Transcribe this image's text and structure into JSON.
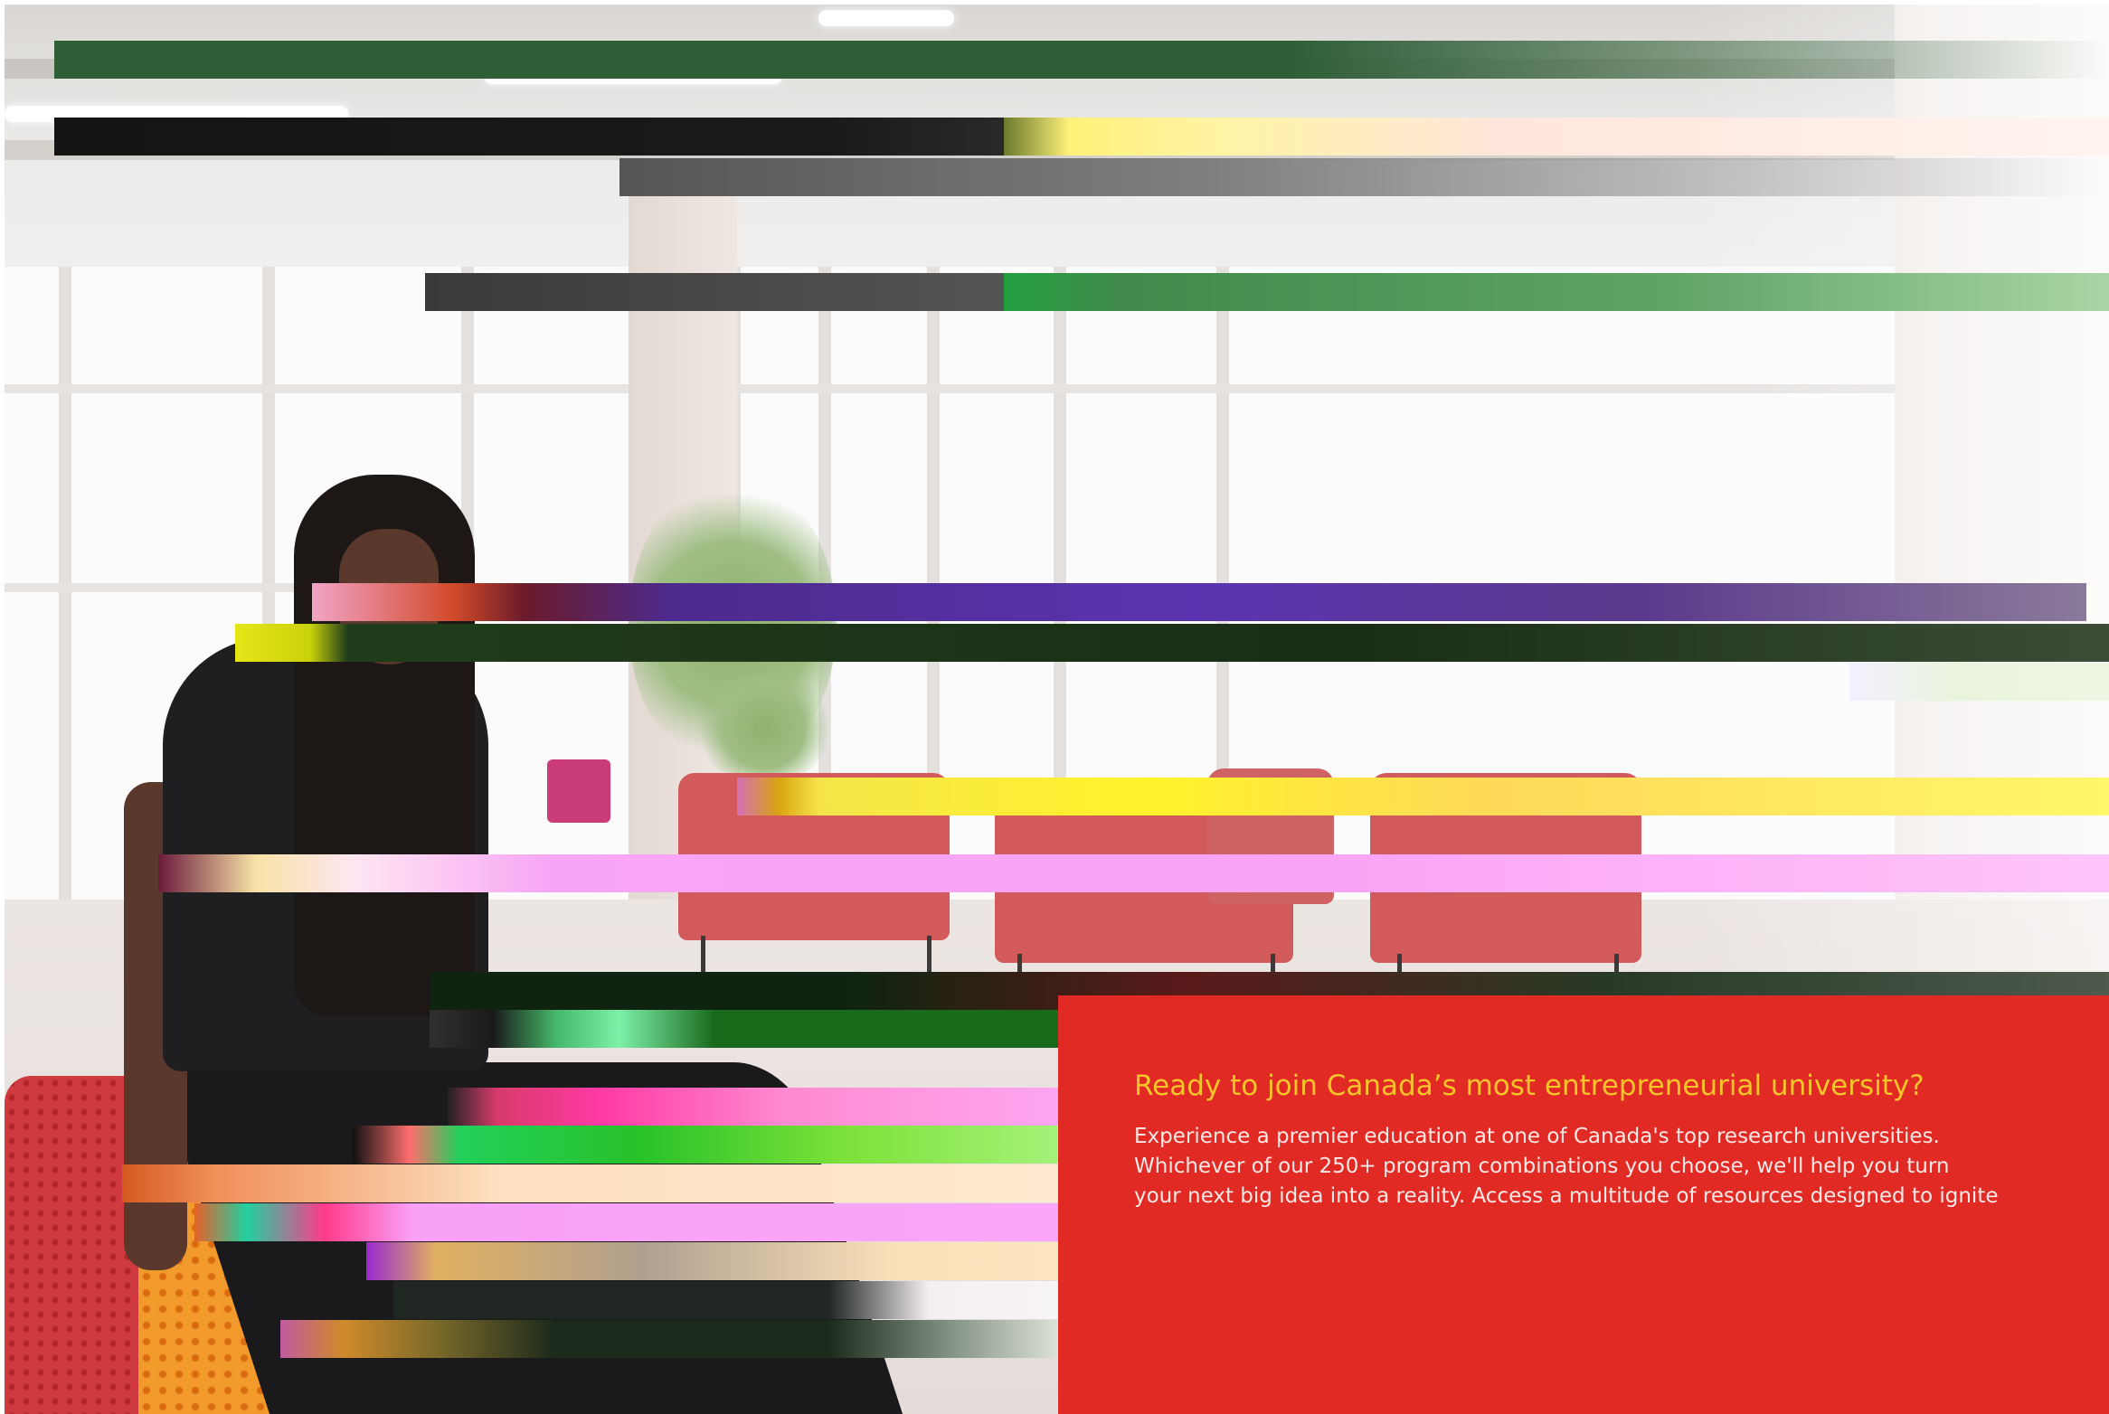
{
  "hero": {
    "image_alt": "",
    "glitch_colors": [
      "#2e5e36",
      "#141414",
      "#6a7a2c",
      "#fff27a",
      "#ffe6dc",
      "#555555",
      "#3f8a4a",
      "#4d2a8c",
      "#1f3d1a",
      "#f6e54a",
      "#f7a6f5",
      "#0f2410",
      "#1a6a1c",
      "#ff8bd0",
      "#a6f27a",
      "#fde0c0",
      "#f9a0f7",
      "#f8dfb8",
      "#202622",
      "#7f8f7f"
    ]
  },
  "promo": {
    "heading": "Ready to join Canada’s most entrepreneurial university?",
    "body_lines": [
      "Experience a premier education at one of Canada's top research universities.",
      "Whichever of our 250+ program combinations you choose, we'll help you turn",
      "your next big idea into a reality. Access a multitude of resources designed to ignite"
    ],
    "colors": {
      "panel_background": "#e22a25",
      "heading": "#f7c42a",
      "body": "#ffe9e6"
    }
  }
}
